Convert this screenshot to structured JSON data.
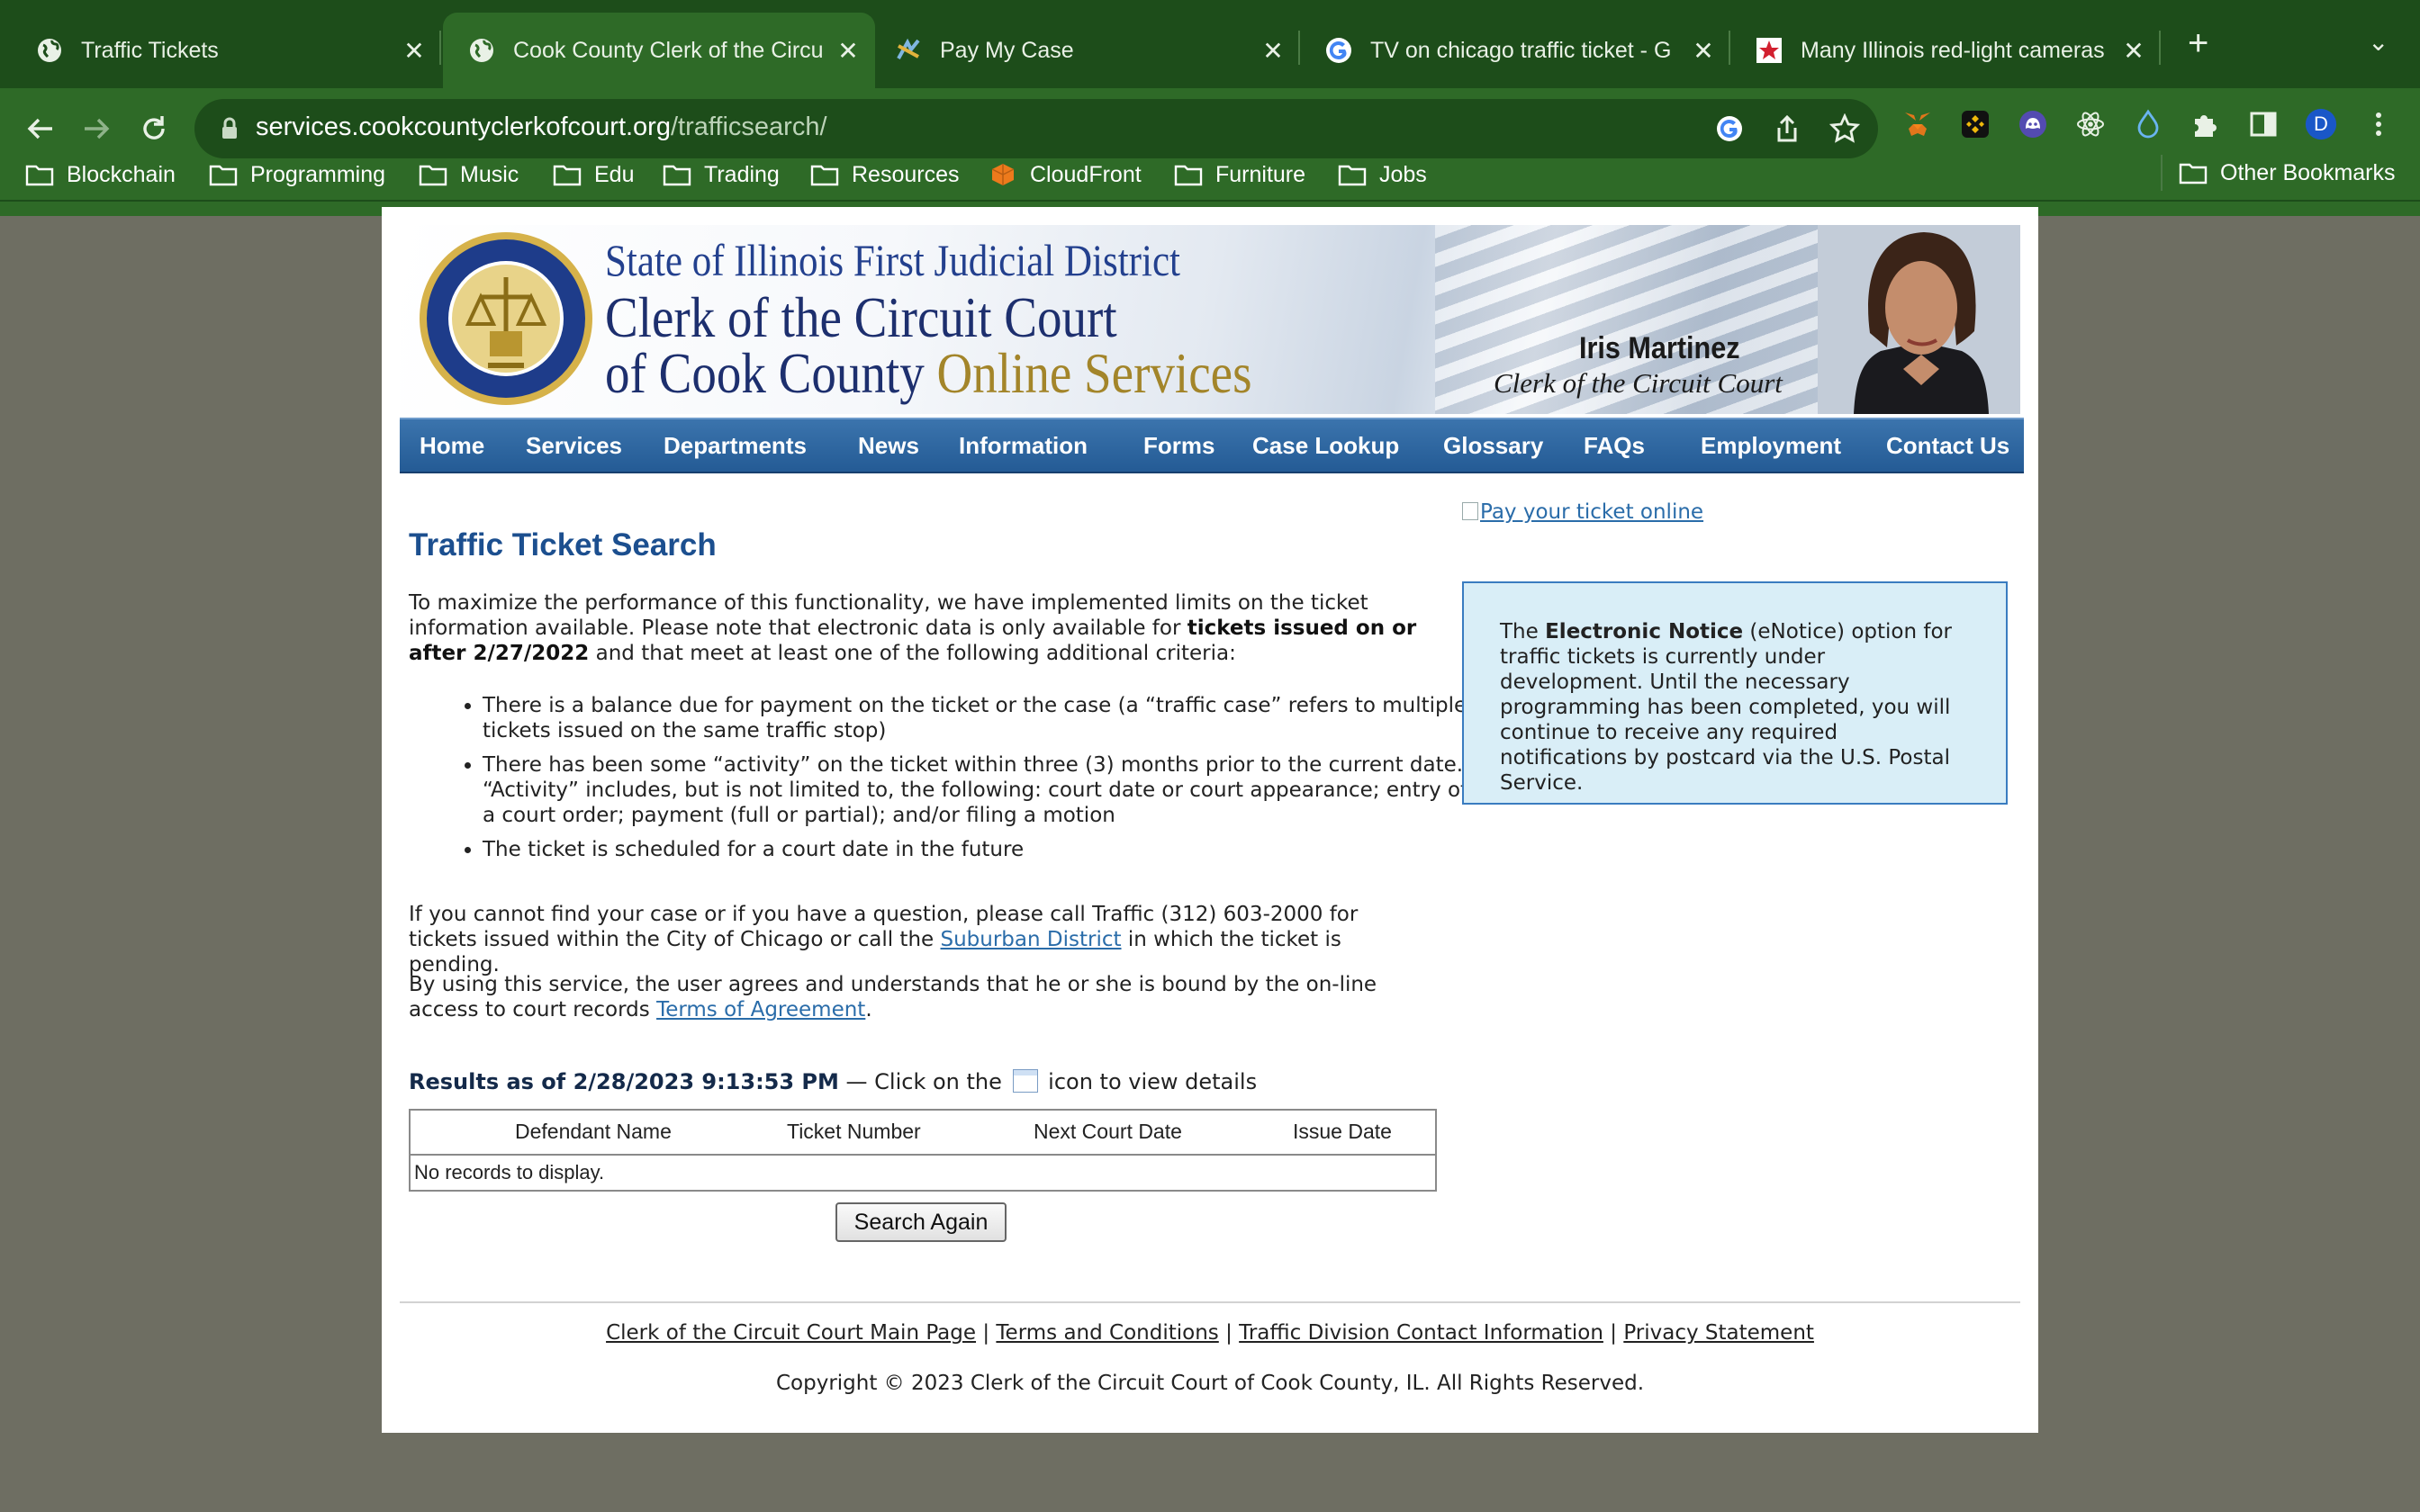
{
  "browser": {
    "tabs": [
      {
        "title": "Traffic Tickets",
        "icon": "globe-icon"
      },
      {
        "title": "Cook County Clerk of the Circu",
        "icon": "globe-icon",
        "active": true
      },
      {
        "title": "Pay My Case",
        "icon": "paymycase-icon"
      },
      {
        "title": "TV on chicago traffic ticket - G",
        "icon": "google-icon"
      },
      {
        "title": "Many Illinois red-light cameras",
        "icon": "chicago-star-icon"
      }
    ],
    "new_tab": "+",
    "url_host": "services.cookcountyclerkofcourt.org",
    "url_path": "/trafficsearch/",
    "profile_initial": "D",
    "bookmarks": [
      "Blockchain",
      "Programming",
      "Music",
      "Edu",
      "Trading",
      "Resources",
      "CloudFront",
      "Furniture",
      "Jobs"
    ],
    "other_bookmarks": "Other Bookmarks"
  },
  "banner": {
    "line1": "State of Illinois First Judicial District",
    "line2": "Clerk of the Circuit Court",
    "line3a": "of Cook County ",
    "line3b": "Online Services",
    "name": "Iris Martinez",
    "title": "Clerk of the Circuit Court"
  },
  "nav": [
    "Home",
    "Services",
    "Departments",
    "News",
    "Information",
    "Forms",
    "Case Lookup",
    "Glossary",
    "FAQs",
    "Employment",
    "Contact Us"
  ],
  "main": {
    "heading": "Traffic Ticket Search",
    "intro_1": "To maximize the performance of this functionality, we have implemented limits on the ticket information available. Please note that electronic data is only available for ",
    "intro_bold": "tickets issued on or after 2/27/2022",
    "intro_2": " and that meet at least one of the following additional criteria:",
    "criteria": [
      "There is a balance due for payment on the ticket or the case (a “traffic case” refers to multiple tickets issued on the same traffic stop)",
      "There has been some “activity” on the ticket within three (3) months prior to the current date. “Activity” includes, but is not limited to, the following: court date or court appearance; entry of a court order; payment (full or partial); and/or filing a motion",
      "The ticket is scheduled for a court date in the future"
    ],
    "contact_1": "If you cannot find your case or if you have a question, please call Traffic (312) 603-2000 for tickets issued within the City of Chicago or call the ",
    "contact_link": "Suburban District",
    "contact_2": " in which the ticket is pending.",
    "terms_1": "By using this service, the user agrees and understands that he or she is bound by the on-line access to court records ",
    "terms_link": "Terms of Agreement",
    "terms_2": ".",
    "results_label": "Results as of 2/28/2023 9:13:53 PM",
    "results_hint_1": " — Click on the ",
    "results_hint_2": " icon to view details",
    "table_headers": [
      "Defendant Name",
      "Ticket Number",
      "Next Court Date",
      "Issue Date"
    ],
    "no_records": "No records to display.",
    "search_again": "Search Again"
  },
  "sidebar": {
    "pay_link": "Pay your ticket online",
    "notice_1": "The ",
    "notice_bold": "Electronic Notice",
    "notice_2": " (eNotice) option for traffic tickets is currently under development. Until the necessary programming has been completed, you will continue to receive any required notifications by postcard via the U.S. Postal Service."
  },
  "footer": {
    "links": [
      "Clerk of the Circuit Court Main Page",
      "Terms and Conditions",
      "Traffic Division Contact Information",
      "Privacy Statement"
    ],
    "separator": "|",
    "copyright": "Copyright © 2023 Clerk of the Circuit Court of Cook County, IL. All Rights Reserved."
  },
  "colors": {
    "chrome_dark": "#1d4d1a",
    "chrome_light": "#2e6a27",
    "nav_blue": "#245b95",
    "heading_blue": "#1c4f8f",
    "notice_bg": "#d9eef7"
  }
}
